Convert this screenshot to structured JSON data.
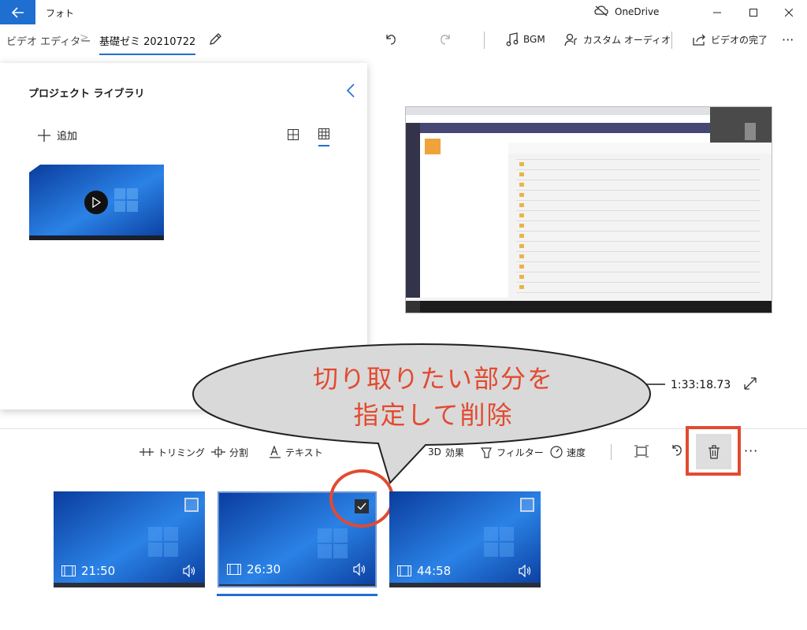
{
  "window": {
    "app_title": "フォト",
    "onedrive_label": "OneDrive"
  },
  "toolbar": {
    "breadcrumb_root": "ビデオ エディター",
    "breadcrumb_separator": ">",
    "project_name": "基礎ゼミ 20210722",
    "bgm_label": "BGM",
    "custom_audio_label": "カスタム オーディオ",
    "finish_video_label": "ビデオの完了",
    "more_label": "···"
  },
  "library": {
    "title": "プロジェクト ライブラリ",
    "add_label": "追加"
  },
  "player": {
    "duration": "1:33:18.73"
  },
  "storyboard": {
    "tools": {
      "trim": "トリミング",
      "split": "分割",
      "text": "テキスト",
      "effects": "効果",
      "filters": "フィルター",
      "speed": "速度"
    },
    "more_label": "···",
    "clips": [
      {
        "duration": "21:50",
        "selected": false
      },
      {
        "duration": "26:30",
        "selected": true
      },
      {
        "duration": "44:58",
        "selected": false
      }
    ]
  },
  "annotation": {
    "line1": "切り取りたい部分を",
    "line2": "指定して削除",
    "highlight_color": "#e24a2f"
  },
  "colors": {
    "accent": "#1f6fd1",
    "callout_fill": "#d9d9d9"
  },
  "icons": [
    "back-arrow-icon",
    "onedrive-icon",
    "minimize-icon",
    "maximize-icon",
    "close-icon",
    "pencil-icon",
    "undo-icon",
    "redo-icon",
    "music-note-icon",
    "custom-audio-icon",
    "share-icon",
    "collapse-icon",
    "plus-icon",
    "grid-small-icon",
    "grid-large-icon",
    "play-icon",
    "fullscreen-icon",
    "trim-icon",
    "split-icon",
    "text-icon",
    "effects-icon",
    "filter-icon",
    "speed-icon",
    "resize-icon",
    "rotate-icon",
    "trash-icon",
    "film-icon",
    "volume-icon",
    "checkmark-icon"
  ]
}
